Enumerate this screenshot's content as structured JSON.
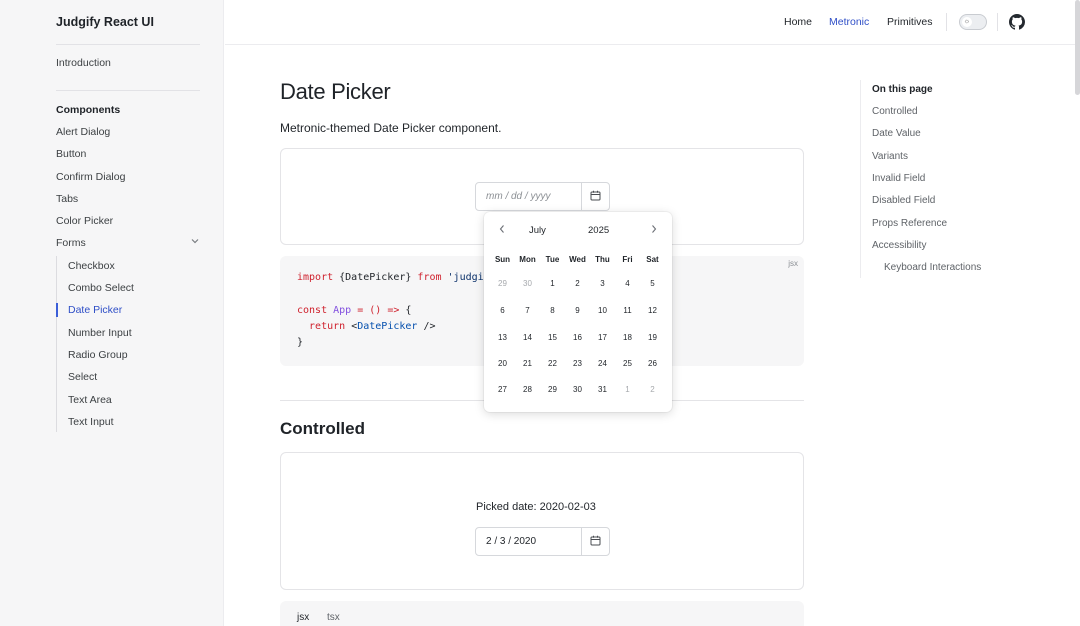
{
  "brand": "Judgify React UI",
  "sidebar": {
    "intro": "Introduction",
    "components_heading": "Components",
    "items": [
      "Alert Dialog",
      "Button",
      "Confirm Dialog",
      "Tabs",
      "Color Picker"
    ],
    "forms_label": "Forms",
    "forms_items": [
      "Checkbox",
      "Combo Select",
      "Date Picker",
      "Number Input",
      "Radio Group",
      "Select",
      "Text Area",
      "Text Input"
    ],
    "active_item": "Date Picker"
  },
  "nav": {
    "home": "Home",
    "metronic": "Metronic",
    "primitives": "Primitives"
  },
  "page": {
    "title": "Date Picker",
    "description": "Metronic-themed Date Picker component.",
    "date_placeholder": "mm / dd / yyyy",
    "code_lang": "jsx",
    "code": {
      "import_kw": "import",
      "import_names": " {DatePicker} ",
      "from_kw": "from",
      "import_src": " 'judgif",
      "const_kw": "const",
      "app_name": " App ",
      "eq_arrow": "= () =>",
      "open_brace": " {",
      "return_kw": "  return",
      "jsx_open": " <",
      "jsx_tag": "DatePicker",
      "jsx_close": " />",
      "close_brace": "}"
    },
    "section_title": "Controlled",
    "picked_date": "Picked date: 2020-02-03",
    "controlled_value": "2 / 3 / 2020",
    "tabs": [
      "jsx",
      "tsx"
    ]
  },
  "calendar": {
    "month": "July",
    "year": "2025",
    "weekdays": [
      "Sun",
      "Mon",
      "Tue",
      "Wed",
      "Thu",
      "Fri",
      "Sat"
    ],
    "weeks": [
      [
        "29",
        "30",
        "1",
        "2",
        "3",
        "4",
        "5"
      ],
      [
        "6",
        "7",
        "8",
        "9",
        "10",
        "11",
        "12"
      ],
      [
        "13",
        "14",
        "15",
        "16",
        "17",
        "18",
        "19"
      ],
      [
        "20",
        "21",
        "22",
        "23",
        "24",
        "25",
        "26"
      ],
      [
        "27",
        "28",
        "29",
        "30",
        "31",
        "1",
        "2"
      ]
    ]
  },
  "toc": {
    "title": "On this page",
    "items": [
      "Controlled",
      "Date Value",
      "Variants",
      "Invalid Field",
      "Disabled Field",
      "Props Reference",
      "Accessibility"
    ],
    "sub_items": [
      "Keyboard Interactions"
    ]
  }
}
